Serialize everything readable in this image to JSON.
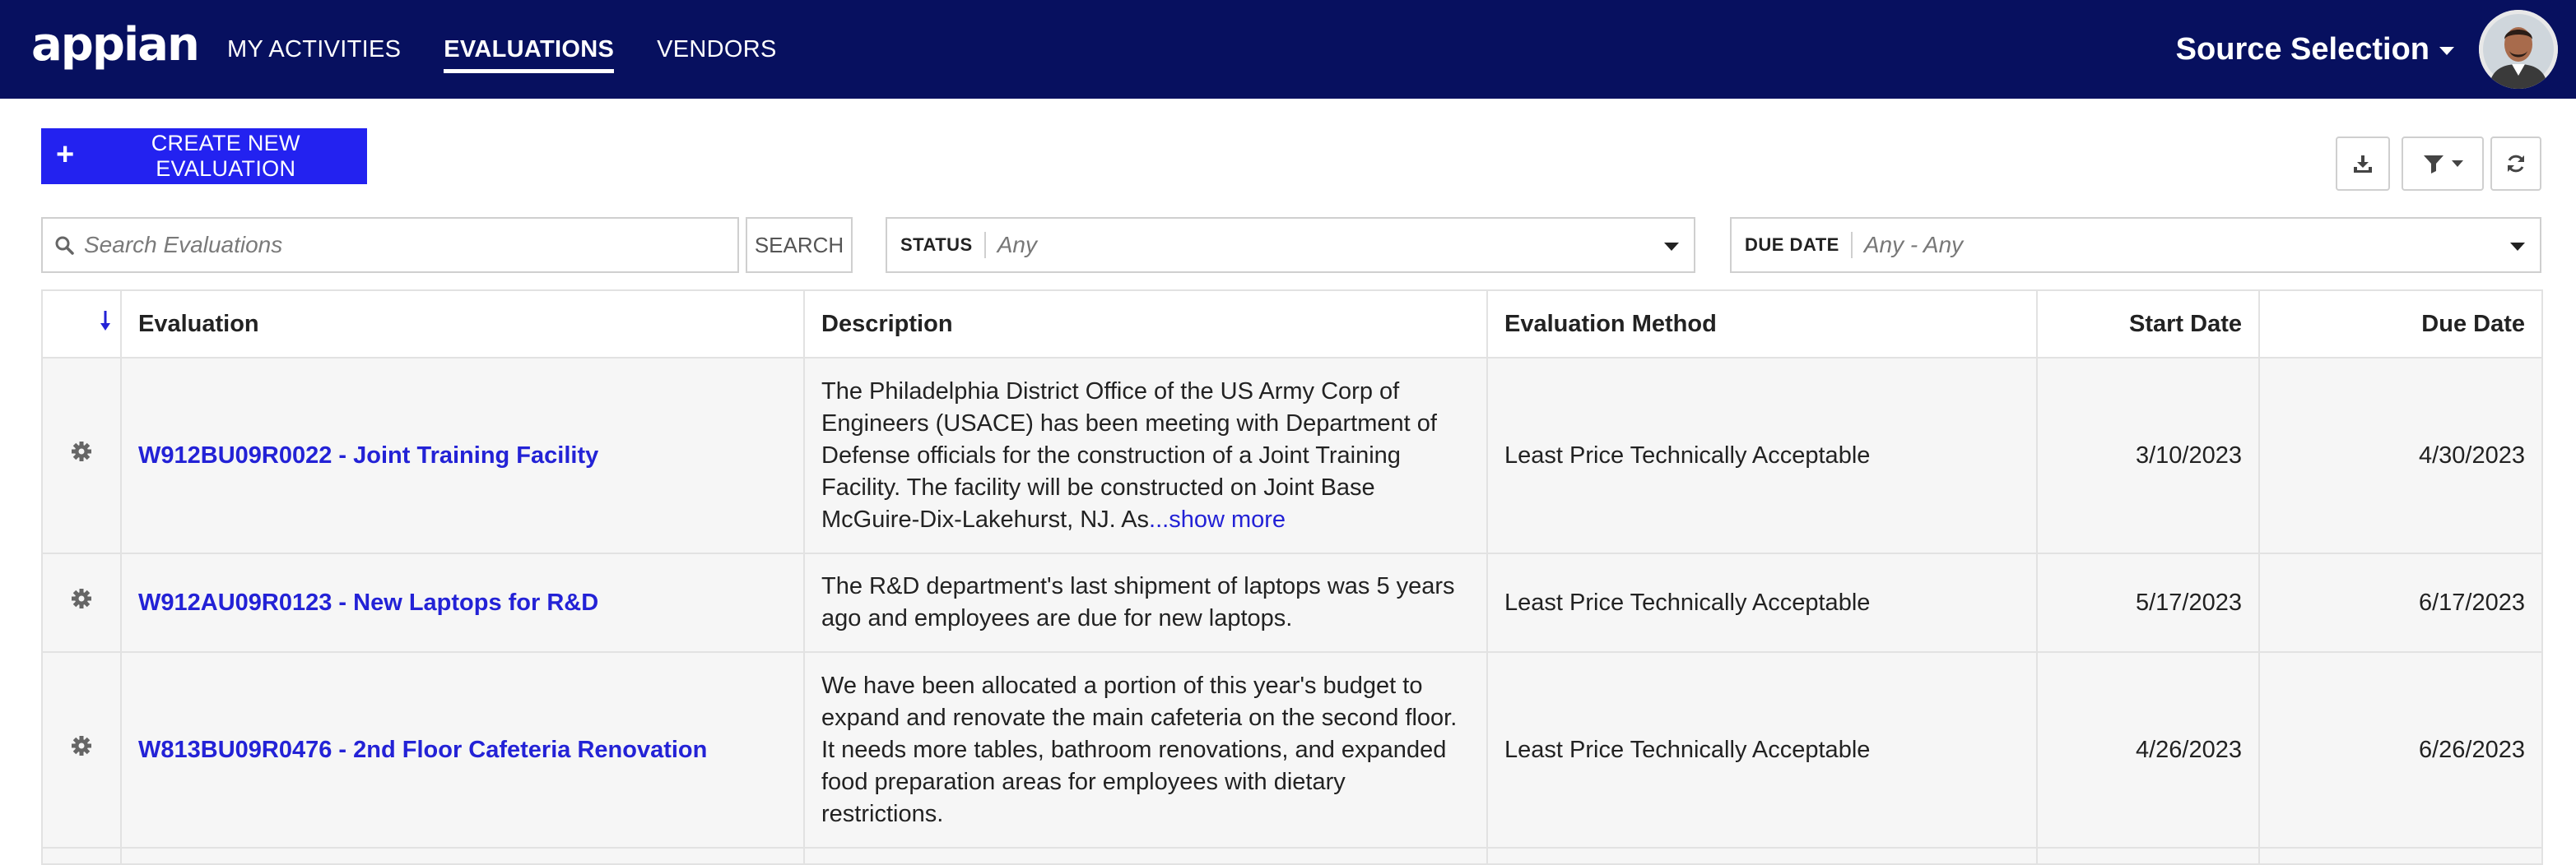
{
  "header": {
    "logo": "appian",
    "nav": [
      {
        "label": "MY ACTIVITIES",
        "active": false
      },
      {
        "label": "EVALUATIONS",
        "active": true
      },
      {
        "label": "VENDORS",
        "active": false
      }
    ],
    "app_name": "Source Selection"
  },
  "toolbar": {
    "create_label": "CREATE NEW EVALUATION",
    "icons": [
      "download-icon",
      "filter-icon",
      "refresh-icon"
    ]
  },
  "filters": {
    "search_placeholder": "Search Evaluations",
    "search_button": "SEARCH",
    "status_label": "STATUS",
    "status_value": "Any",
    "due_date_label": "DUE DATE",
    "due_date_value": "Any - Any"
  },
  "table": {
    "columns": [
      "Evaluation",
      "Description",
      "Evaluation Method",
      "Start Date",
      "Due Date"
    ],
    "sort": "descending",
    "rows": [
      {
        "evaluation": "W912BU09R0022 - Joint Training Facility",
        "description": "The Philadelphia District Office of the US Army Corp of Engineers (USACE) has been meeting with Department of Defense officials for the construction of a Joint Training Facility. The facility will be constructed on Joint Base McGuire-Dix-Lakehurst, NJ. As",
        "more": "...show more",
        "method": "Least Price Technically Acceptable",
        "start": "3/10/2023",
        "due": "4/30/2023"
      },
      {
        "evaluation": "W912AU09R0123 - New Laptops for R&D",
        "description": "The R&D department's last shipment of laptops was 5 years ago and employees are due for new laptops.",
        "more": "",
        "method": "Least Price Technically Acceptable",
        "start": "5/17/2023",
        "due": "6/17/2023"
      },
      {
        "evaluation": "W813BU09R0476 - 2nd Floor Cafeteria Renovation",
        "description": "We have been allocated a portion of this year's budget to expand and renovate the main cafeteria on the second floor. It needs more tables, bathroom renovations, and expanded food preparation areas for employees with dietary restrictions.",
        "more": "",
        "method": "Least Price Technically Acceptable",
        "start": "4/26/2023",
        "due": "6/26/2023"
      }
    ]
  },
  "colors": {
    "header_bg": "#07105f",
    "accent": "#2322f0",
    "link": "#2322d6"
  }
}
